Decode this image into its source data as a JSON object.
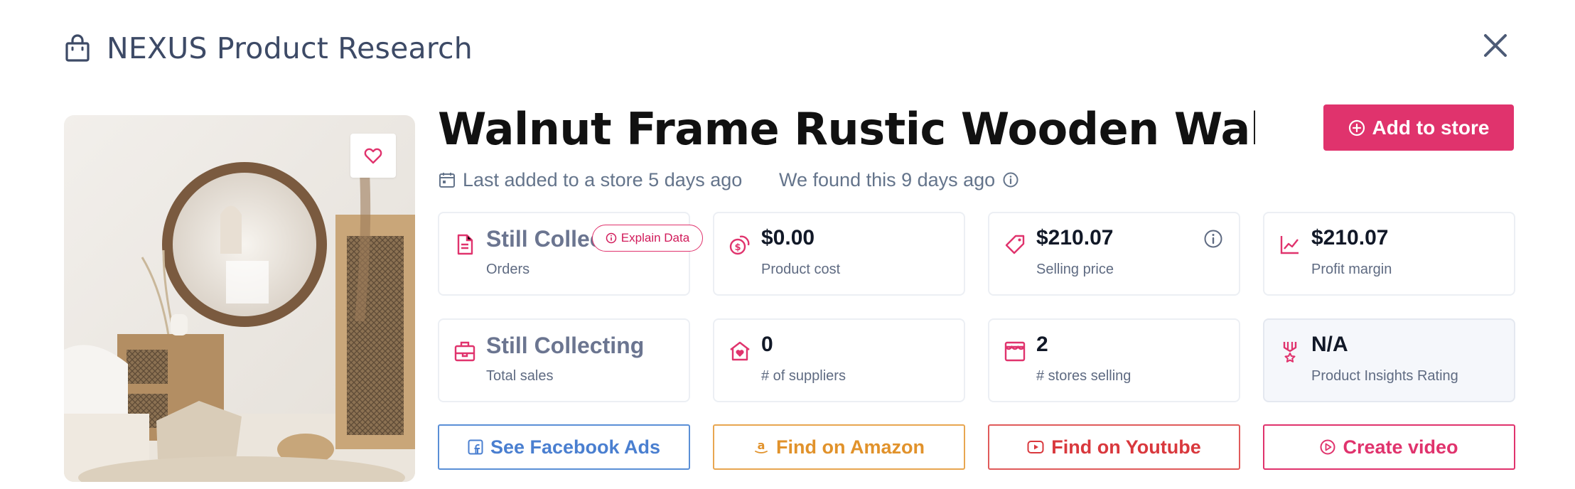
{
  "header": {
    "title": "NEXUS Product Research"
  },
  "product": {
    "title": "Walnut Frame Rustic Wooden Wall Mi…",
    "last_added": "Last added to a store 5 days ago",
    "found": "We found this 9 days ago"
  },
  "buttons": {
    "add_to_store": "Add to store"
  },
  "explain_label": "Explain Data",
  "stats": [
    {
      "value": "Still Collecting",
      "label": "Orders",
      "icon": "document-icon"
    },
    {
      "value": "$0.00",
      "label": "Product cost",
      "icon": "coins-icon"
    },
    {
      "value": "$210.07",
      "label": "Selling price",
      "icon": "price-tag-icon"
    },
    {
      "value": "$210.07",
      "label": "Profit margin",
      "icon": "chart-line-icon"
    },
    {
      "value": "Still Collecting",
      "label": "Total sales",
      "icon": "cash-register-icon"
    },
    {
      "value": "0",
      "label": "# of suppliers",
      "icon": "house-heart-icon"
    },
    {
      "value": "2",
      "label": "# stores selling",
      "icon": "storefront-icon"
    },
    {
      "value": "N/A",
      "label": "Product Insights Rating",
      "icon": "award-icon"
    }
  ],
  "actions": {
    "facebook": "See Facebook Ads",
    "amazon": "Find on Amazon",
    "youtube": "Find on Youtube",
    "video": "Create video"
  },
  "colors": {
    "accent": "#e0336d",
    "title_text": "#3d4a66",
    "facebook": "#4a7fd0",
    "amazon": "#e1922b",
    "youtube": "#d9383d"
  }
}
